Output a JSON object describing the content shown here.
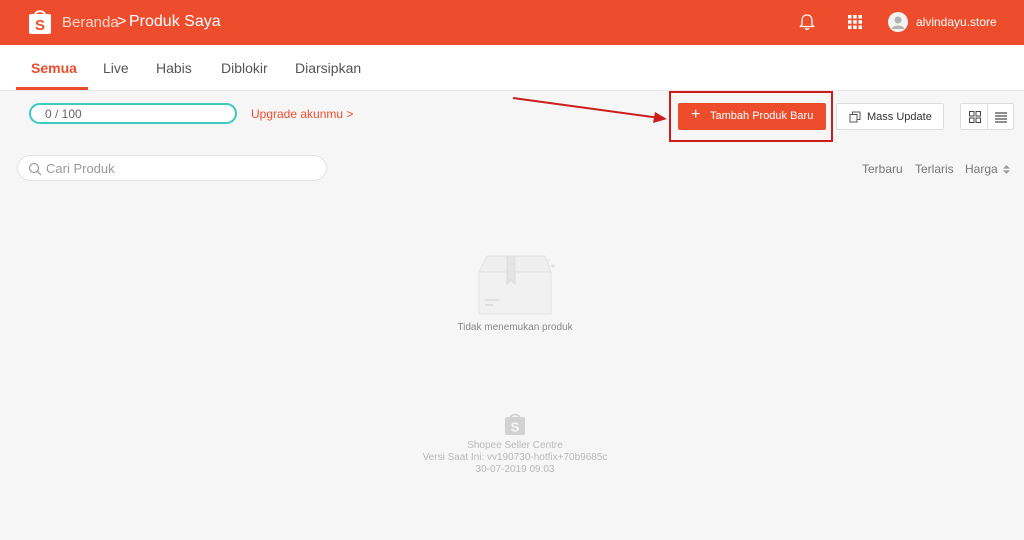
{
  "header": {
    "breadcrumb_home": "Beranda",
    "breadcrumb_separator": ">",
    "breadcrumb_current": "Produk Saya",
    "username": "alvindayu.store",
    "icons": [
      "shopee-bag-icon",
      "bell-icon",
      "apps-grid-icon",
      "user-avatar-icon"
    ]
  },
  "tabs": [
    {
      "label": "Semua",
      "active": true
    },
    {
      "label": "Live",
      "active": false
    },
    {
      "label": "Habis",
      "active": false
    },
    {
      "label": "Diblokir",
      "active": false
    },
    {
      "label": "Diarsipkan",
      "active": false
    }
  ],
  "toolbar": {
    "quota": "0 / 100",
    "upgrade_link": "Upgrade akunmu >",
    "add_product_label": "Tambah Produk Baru",
    "mass_update_label": "Mass Update"
  },
  "search": {
    "placeholder": "Cari Produk",
    "value": ""
  },
  "sort": {
    "options": [
      "Terbaru",
      "Terlaris",
      "Harga"
    ]
  },
  "empty_state": {
    "message": "Tidak menemukan produk"
  },
  "footer": {
    "title": "Shopee Seller Centre",
    "version": "Versi Saat Ini: vv190730-hotfix+70b9685c",
    "date": "30-07-2019 09:03"
  },
  "colors": {
    "brand": "#ee4d2d",
    "quota_border": "#3cc9c0",
    "annotation": "#cc1d1d"
  }
}
